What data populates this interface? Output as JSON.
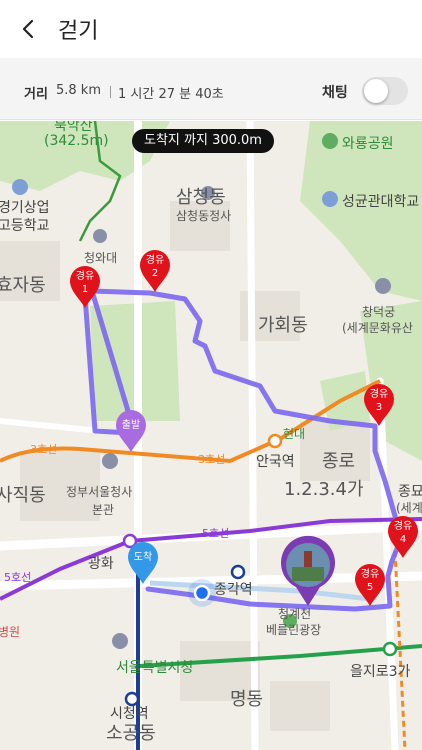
{
  "header": {
    "title": "걷기"
  },
  "info": {
    "distance_label": "거리",
    "distance_value": "5.8 km",
    "time_value": "1 시간 27 분 40초",
    "chat_label": "채팅",
    "chat_enabled": false
  },
  "map": {
    "destination_pill": "도착지 까지 300.0m",
    "labels": {
      "bugaksan": "북악산",
      "bugaksan_height": "(342.5m)",
      "samcheong": "삼청동",
      "samcheong_office": "삼청동정사",
      "cheongwadae": "청와대",
      "hyoja": "효자동",
      "gyeonggi_school": "경기상업",
      "gyeonggi_school2": "고등학교",
      "waryong": "와룡공원",
      "sungkyunkwan": "성균관대학교",
      "gahoe": "가회동",
      "changdeokgung": "창덕궁",
      "changdeokgung2": "(세계문화유산",
      "line3_a": "3호선",
      "line3_b": "3호선",
      "anguk": "안국역",
      "hyeondae": "현대",
      "jongno": "종로",
      "jongno_sub": "1.2.3.4가",
      "jongno_right": "종묘",
      "jongno_right2": "(세계문화",
      "sajik": "사직동",
      "gov_complex": "정부서울청사",
      "gov_complex2": "본관",
      "line5_a": "5호선",
      "line5_b": "5호선",
      "gwanghwa": "광화",
      "jonggak": "종각역",
      "cheonggye": "청계천",
      "berlin": "베를린광장",
      "euljiro": "을지로3가",
      "seoul_cityhall": "서울특별시청",
      "cityhall_station": "시청역",
      "sogong": "소공동",
      "myeongdong": "명동",
      "hospital": "병원"
    },
    "start_pin": "출발",
    "arrival_pin": "도착",
    "waypoints": [
      {
        "label": "경유",
        "num": "1"
      },
      {
        "label": "경유",
        "num": "2"
      },
      {
        "label": "경유",
        "num": "3"
      },
      {
        "label": "경유",
        "num": "4"
      },
      {
        "label": "경유",
        "num": "5"
      }
    ],
    "colors": {
      "route": "#7b66f0",
      "waypoint_pin": "#e0121b",
      "start_pin": "#a86be0",
      "arrival_pin": "#3399e6",
      "current_location": "#1e6ff0",
      "line3": "#f08a24",
      "line5": "#8a3bd6",
      "line2": "#25a04b",
      "line1": "#1c3f95",
      "park": "#c9e5b4"
    }
  }
}
